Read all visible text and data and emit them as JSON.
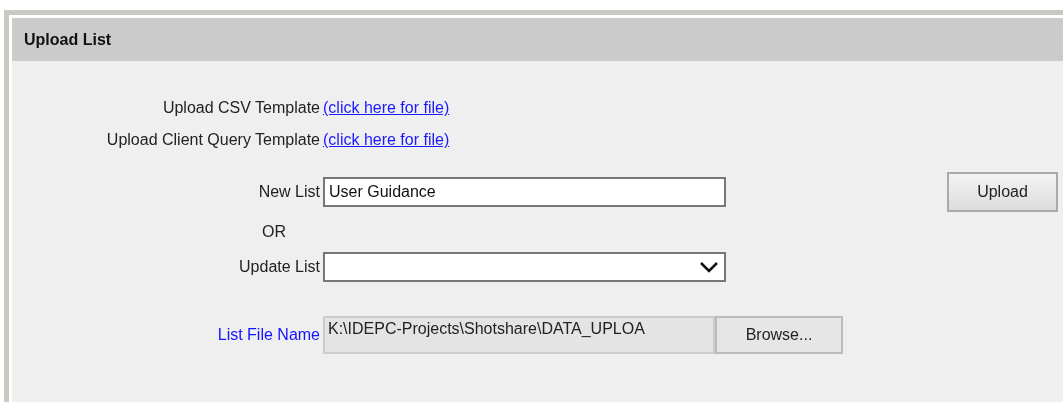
{
  "panel": {
    "title": "Upload List"
  },
  "templates": [
    {
      "label": "Upload CSV Template",
      "link": "(click here for file)"
    },
    {
      "label": "Upload Client Query Template",
      "link": "(click here for file)"
    }
  ],
  "new_list": {
    "label": "New List",
    "value": "User Guidance"
  },
  "separator": "OR",
  "update_list": {
    "label": "Update List"
  },
  "upload_button": "Upload",
  "file": {
    "label": "List File Name",
    "value": "K:\\IDEPC-Projects\\Shotshare\\DATA_UPLOA",
    "button": "Browse..."
  }
}
